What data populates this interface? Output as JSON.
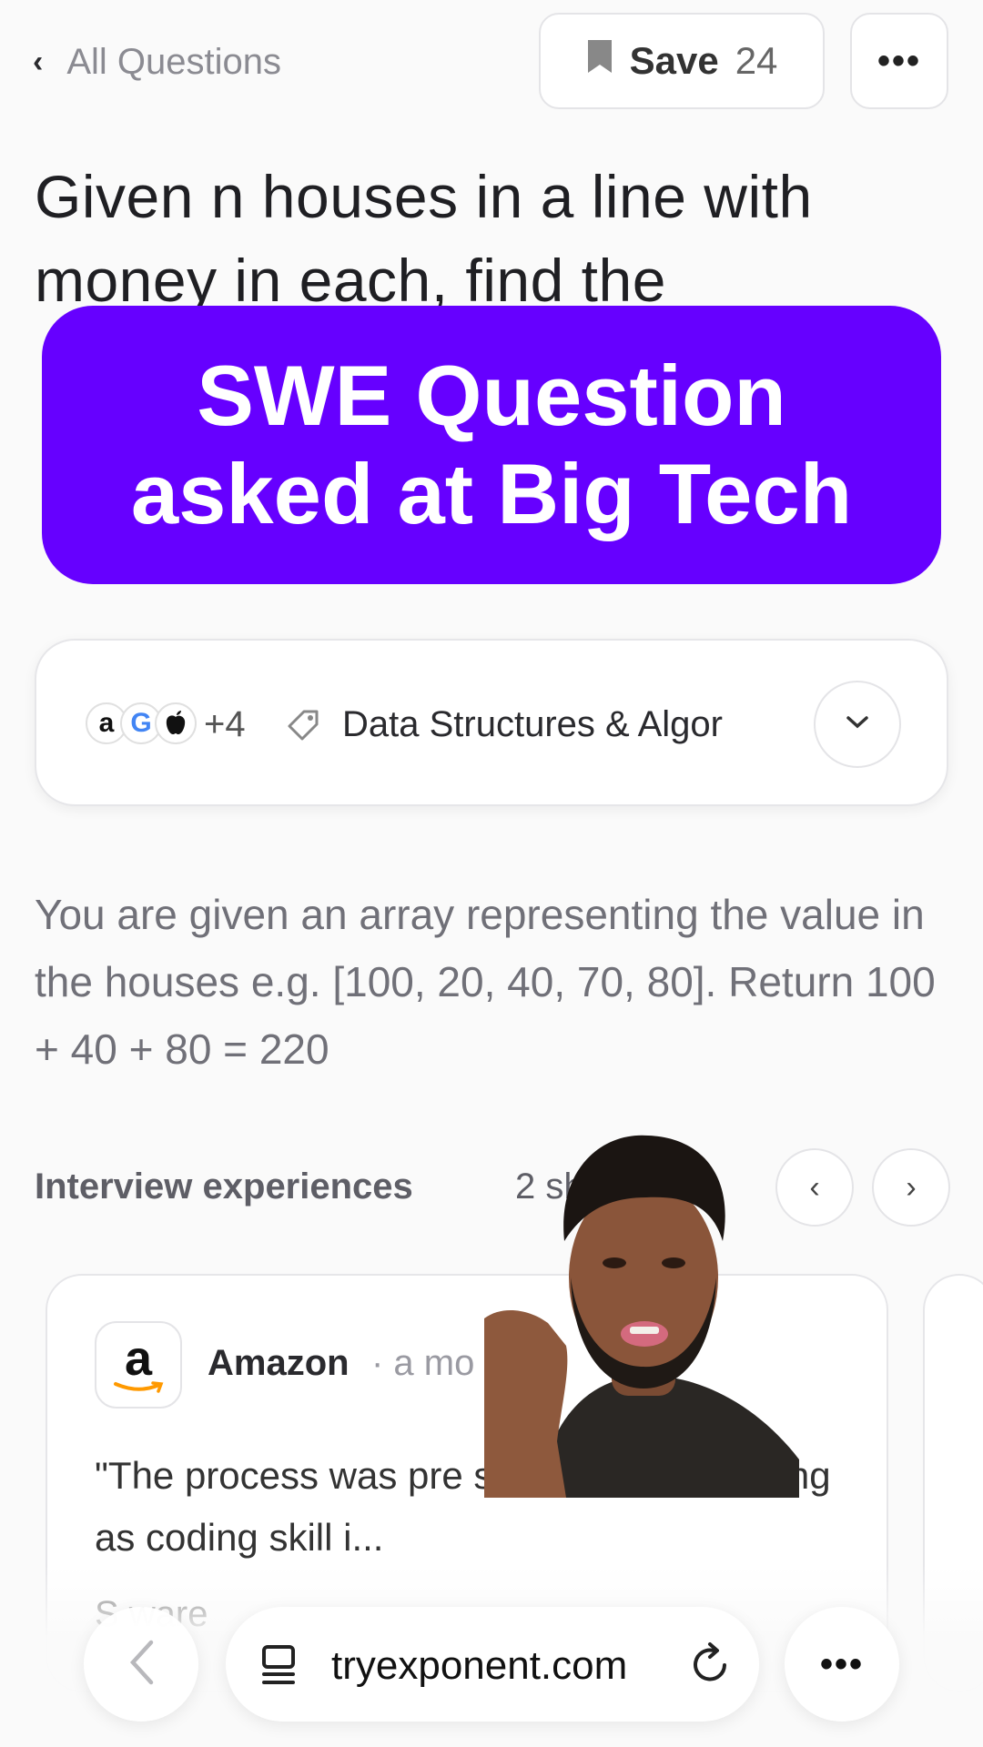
{
  "header": {
    "back_label": "All Questions",
    "save_label": "Save",
    "save_count": "24",
    "more_label": "•••"
  },
  "question": {
    "title": "Given n houses in a line with money in each, find the"
  },
  "banner": {
    "line1": "SWE Question",
    "line2": "asked at Big Tech"
  },
  "tags": {
    "company_logos": [
      "a",
      "G",
      ""
    ],
    "extra_count": "+4",
    "topic": "Data Structures & Algor"
  },
  "description": "You are given an array representing the value in the houses e.g. [100, 20, 40, 70, 80]. Return 100 + 40 + 80 = 220",
  "experiences": {
    "title": "Interview experiences",
    "count": "2 sh",
    "prev_label": "‹",
    "next_label": "›",
    "card": {
      "logo_letter": "a",
      "company": "Amazon",
      "when": "· a mo",
      "quote": "\"The process was pre straitforward. As long as coding skill i...",
      "role": "S   ware"
    }
  },
  "browser": {
    "url": "tryexponent.com",
    "more_label": "•••"
  },
  "colors": {
    "banner": "#6600ff",
    "google_g": "#4285f4",
    "amazon_arrow": "#ff9900"
  }
}
